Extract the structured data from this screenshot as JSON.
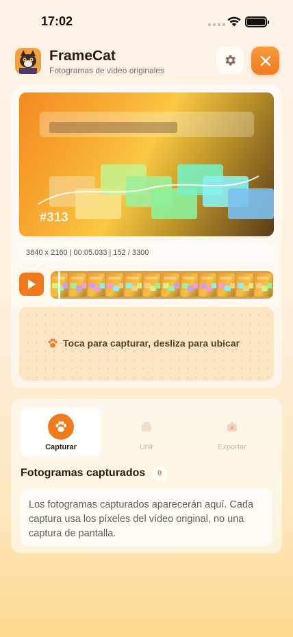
{
  "status_bar": {
    "time": "17:02"
  },
  "header": {
    "app_name": "FrameCat",
    "subtitle": "Fotogramas de vídeo originales",
    "settings_icon": "gear-icon",
    "close_icon": "close-icon"
  },
  "preview": {
    "frame_label": "#313"
  },
  "meta": {
    "info": "3840 x 2160  |  00:05.033  |  152 / 3300"
  },
  "timeline": {
    "play_icon": "play-icon",
    "frame_count": 12
  },
  "capture_area": {
    "hint": "Toca para capturar, desliza para ubicar",
    "icon": "paw-icon"
  },
  "tabs": [
    {
      "label": "Capturar",
      "icon": "paw-icon",
      "state": "active"
    },
    {
      "label": "Unir",
      "icon": "merge-icon",
      "state": "disabled"
    },
    {
      "label": "Exportar",
      "icon": "export-icon",
      "state": "disabled"
    }
  ],
  "captured": {
    "title": "Fotogramas capturados",
    "count": "0",
    "empty_message": "Los fotogramas capturados aparecerán aquí. Cada captura usa los píxeles del vídeo original, no una captura de pantalla."
  },
  "colors": {
    "accent": "#f07a1e",
    "background": "#fdf3e8"
  }
}
